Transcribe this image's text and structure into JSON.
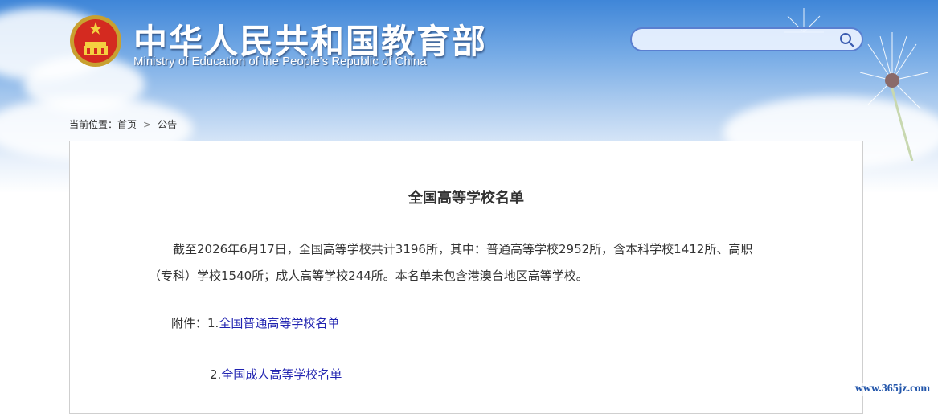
{
  "header": {
    "title_cn": "中华人民共和国教育部",
    "title_en": "Ministry of Education of the People's Republic of China",
    "search": {
      "placeholder": "",
      "value": ""
    }
  },
  "breadcrumb": {
    "prefix": "当前位置：",
    "home": "首页",
    "separator": ">",
    "current": "公告"
  },
  "article": {
    "title": "全国高等学校名单",
    "paragraph_line1": "截至2026年6月17日，全国高等学校共计3196所，其中：普通高等学校2952所，含本科学校1412所、高职",
    "paragraph_line2": "（专科）学校1540所；成人高等学校244所。本名单未包含港澳台地区高等学校。",
    "attachments_label": "附件：",
    "attachments": [
      {
        "prefix": "1.",
        "label": "全国普通高等学校名单"
      },
      {
        "prefix": "2.",
        "label": "全国成人高等学校名单"
      }
    ]
  },
  "watermark": "www.365jz.com",
  "colors": {
    "link": "#1f22b0",
    "text": "#333333",
    "banner": "#3f86d8"
  }
}
